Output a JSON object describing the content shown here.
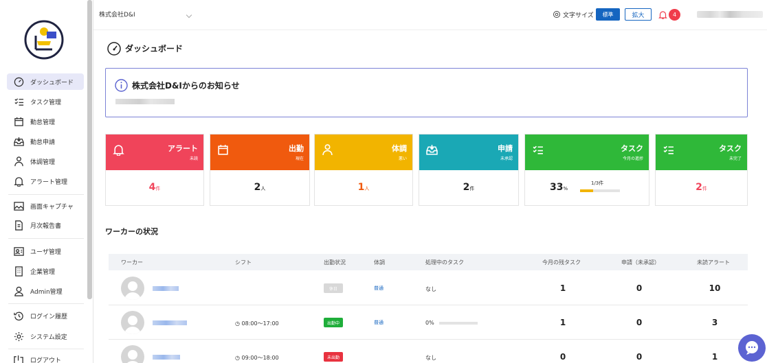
{
  "sidebar": {
    "items": [
      {
        "label": "ダッシュボード",
        "icon": "dashboard-icon",
        "active": true
      },
      {
        "label": "タスク管理",
        "icon": "task-list-icon"
      },
      {
        "label": "勤怠管理",
        "icon": "calendar-icon"
      },
      {
        "label": "勤怠申請",
        "icon": "inbox-icon"
      },
      {
        "label": "体調管理",
        "icon": "health-icon"
      },
      {
        "label": "アラート管理",
        "icon": "bell-icon"
      },
      {
        "label": "画面キャプチャ",
        "icon": "image-icon"
      },
      {
        "label": "月次報告書",
        "icon": "document-icon"
      },
      {
        "label": "ユーザ管理",
        "icon": "user-card-icon"
      },
      {
        "label": "企業管理",
        "icon": "building-icon"
      },
      {
        "label": "Admin管理",
        "icon": "admin-icon"
      },
      {
        "label": "ログイン履歴",
        "icon": "history-icon"
      },
      {
        "label": "システム設定",
        "icon": "gear-icon"
      },
      {
        "label": "ログアウト",
        "icon": "logout-icon"
      }
    ]
  },
  "topbar": {
    "company": "株式会社D&I",
    "font_size_label": "文字サイズ",
    "font_std": "標準",
    "font_large": "拡大",
    "alert_count": "4"
  },
  "page": {
    "title": "ダッシュボード"
  },
  "notice": {
    "title": "株式会社D&Iからのお知らせ"
  },
  "cards": [
    {
      "title": "アラート",
      "sub": "未読",
      "value": "4",
      "unit": "件",
      "color": "#f0445a"
    },
    {
      "title": "出勤",
      "sub": "現在",
      "value": "2",
      "unit": "人",
      "color": "#f05a0e"
    },
    {
      "title": "体調",
      "sub": "悪い",
      "value": "1",
      "unit": "人",
      "color": "#f2b400"
    },
    {
      "title": "申請",
      "sub": "未承認",
      "value": "2",
      "unit": "件",
      "color": "#1aa8b5"
    },
    {
      "title": "タスク",
      "sub": "今月の進捗",
      "value": "33",
      "unit": "%",
      "progress_label": "1/3件",
      "progress": 0.33,
      "color": "#2fb839"
    },
    {
      "title": "タスク",
      "sub": "未完了",
      "value": "2",
      "unit": "件",
      "color": "#2fb839"
    }
  ],
  "workers": {
    "title": "ワーカーの状況",
    "headers": [
      "ワーカー",
      "シフト",
      "出勤状況",
      "体調",
      "処理中のタスク",
      "今月の残タスク",
      "申請（未承認）",
      "未読アラート"
    ],
    "rows": [
      {
        "shift": "",
        "status": "休日",
        "status_color": "#d8d8d8",
        "condition": "普通",
        "task": "なし",
        "remaining": "1",
        "requests": "0",
        "alerts": "10"
      },
      {
        "shift": "08:00～17:00",
        "status": "出勤中",
        "status_color": "#1fae3a",
        "condition": "普通",
        "task": "0%",
        "remaining": "1",
        "requests": "0",
        "alerts": "3"
      },
      {
        "shift": "09:00～18:00",
        "status": "未出勤",
        "status_color": "#e8323f",
        "condition": "",
        "task": "なし",
        "remaining": "0",
        "requests": "0",
        "alerts": "1"
      }
    ]
  }
}
